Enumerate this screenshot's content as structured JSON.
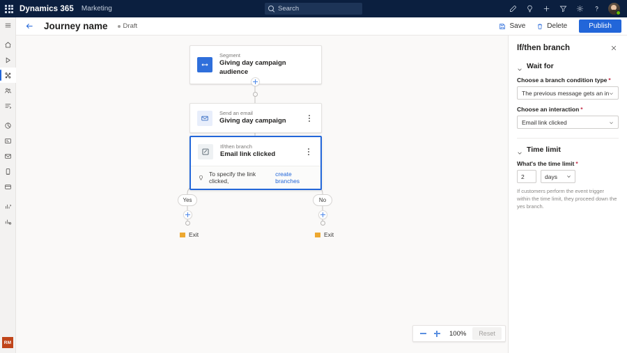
{
  "suitebar": {
    "waffle_label": "app-launcher",
    "brand": "Dynamics 365",
    "app": "Marketing",
    "search_placeholder": "Search",
    "icons": [
      {
        "name": "edit-icon",
        "label": "Edit"
      },
      {
        "name": "lightbulb-icon",
        "label": "Insights"
      },
      {
        "name": "plus-icon",
        "label": "New"
      },
      {
        "name": "filter-icon",
        "label": "Filter"
      },
      {
        "name": "gear-icon",
        "label": "Settings"
      },
      {
        "name": "help-icon",
        "label": "Help"
      }
    ],
    "avatar_label": "User account",
    "presence_color": "#6bb700"
  },
  "rail": {
    "items": [
      {
        "name": "hamburger-menu-icon",
        "label": "Menu"
      },
      {
        "name": "home-icon",
        "label": "Home"
      },
      {
        "name": "recent-icon",
        "label": "Recent"
      },
      {
        "name": "journeys-icon",
        "label": "Customer journeys"
      },
      {
        "name": "segments-icon",
        "label": "Segments"
      },
      {
        "name": "flow-icon",
        "label": "Flows"
      },
      {
        "name": "analytics-icon",
        "label": "Analytics"
      },
      {
        "name": "forms-icon",
        "label": "Marketing forms"
      },
      {
        "name": "email-icon",
        "label": "Marketing emails"
      },
      {
        "name": "mobile-icon",
        "label": "Mobile"
      },
      {
        "name": "page-icon",
        "label": "Pages"
      },
      {
        "name": "chart-icon",
        "label": "Reports"
      },
      {
        "name": "chart-settings-icon",
        "label": "Report settings"
      }
    ],
    "selected_index": 3,
    "badge": "RM"
  },
  "commandbar": {
    "back_label": "Back",
    "title": "Journey name",
    "status": "Draft",
    "save_label": "Save",
    "delete_label": "Delete",
    "publish_label": "Publish"
  },
  "canvas": {
    "nodes": [
      {
        "id": "segment",
        "icon": "segment-icon",
        "kicker": "Segment",
        "title": "Giving day campaign audience",
        "selected": false,
        "has_kebab": false
      },
      {
        "id": "email",
        "icon": "envelope-icon",
        "kicker": "Send an email",
        "title": "Giving day campaign",
        "selected": false,
        "has_kebab": true
      },
      {
        "id": "branch",
        "icon": "branch-icon",
        "kicker": "If/then branch",
        "title": "Email link clicked",
        "selected": true,
        "has_kebab": true,
        "tip_text": "To specify the link clicked,",
        "tip_link": "create branches"
      }
    ],
    "branches": [
      {
        "label": "Yes",
        "exit_label": "Exit"
      },
      {
        "label": "No",
        "exit_label": "Exit"
      }
    ],
    "add_step_label": "Add step"
  },
  "zoom_controls": {
    "zoom_out_label": "Zoom out",
    "zoom_in_label": "Zoom in",
    "level": "100%",
    "reset_label": "Reset"
  },
  "panel": {
    "title": "If/then branch",
    "close_label": "Close",
    "sections": [
      {
        "title": "Wait for",
        "fields": [
          {
            "label": "Choose a branch condition type",
            "required": true,
            "value": "The previous message gets an interaction"
          },
          {
            "label": "Choose an interaction",
            "required": true,
            "value": "Email link clicked"
          }
        ]
      },
      {
        "title": "Time limit",
        "field_label": "What's the time limit",
        "required": true,
        "amount": "2",
        "unit": "days",
        "helper": "If customers perform the event trigger within the time limit, they proceed down the yes branch."
      }
    ]
  },
  "colors": {
    "suitebar_bg": "#0b1f3f",
    "accent": "#2266d9",
    "canvas_bg": "#faf9f8",
    "flag": "#eda830",
    "badge": "#c0451a"
  }
}
